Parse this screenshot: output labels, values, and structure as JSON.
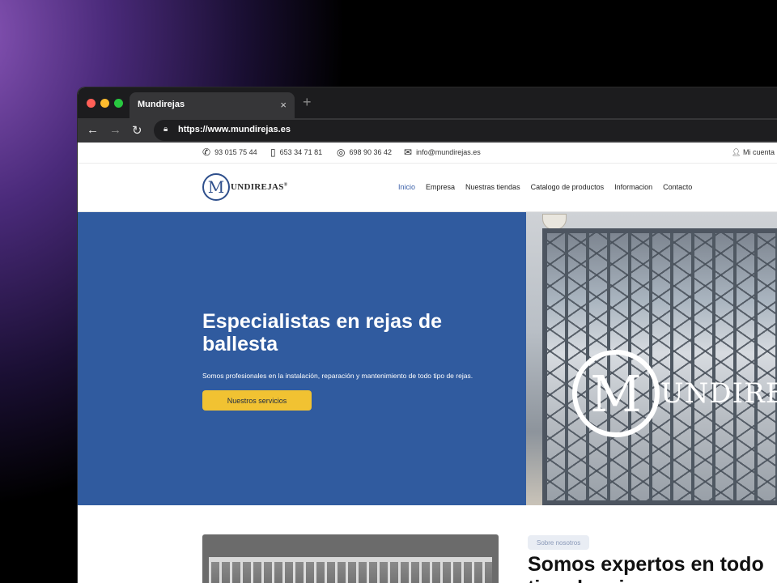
{
  "browser": {
    "tab_title": "Mundirejas",
    "tab_close": "×",
    "new_tab": "+",
    "url": "https://www.mundirejas.es"
  },
  "topbar": {
    "phone": "93 015 75 44",
    "mobile": "653 34 71 81",
    "whatsapp": "698 90 36 42",
    "email": "info@mundirejas.es",
    "account": "Mi cuenta"
  },
  "logo": {
    "mark": "M",
    "text": "UNDIREJAS",
    "reg": "®"
  },
  "nav": {
    "items": [
      "Inicio",
      "Empresa",
      "Nuestras tiendas",
      "Catalogo de productos",
      "Informacion",
      "Contacto"
    ]
  },
  "hero": {
    "title": "Especialistas en rejas de ballesta",
    "subtitle": "Somos profesionales en la instalación, reparación y mantenimiento de todo tipo de rejas.",
    "button": "Nuestros servicios",
    "logo_mark": "M",
    "logo_text": "UNDIREJ"
  },
  "about": {
    "badge": "Sobre nosotros",
    "title": "Somos expertos en todo tipo de rejas"
  },
  "colors": {
    "hero_blue": "#305b9f",
    "cta_yellow": "#f1c232",
    "nav_active": "#3a5fa8"
  }
}
